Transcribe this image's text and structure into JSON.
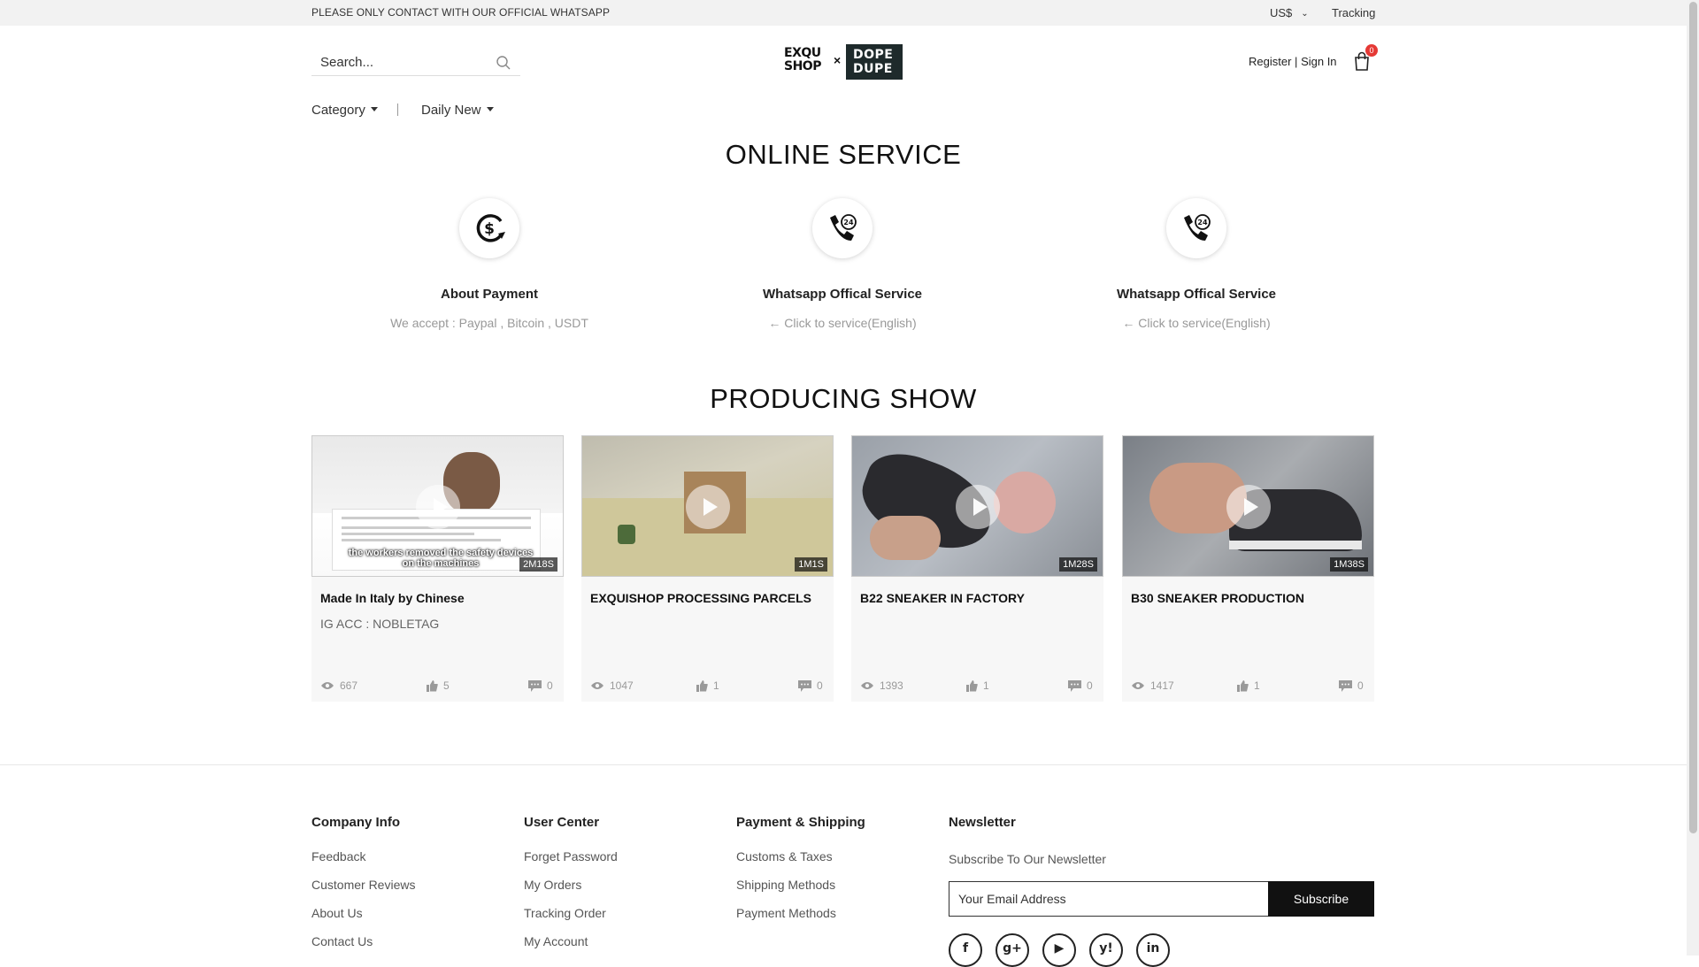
{
  "topbar": {
    "notice": "PLEASE ONLY CONTACT WITH OUR OFFICIAL WHATSAPP",
    "currency": "US$",
    "tracking": "Tracking"
  },
  "header": {
    "search_placeholder": "Search...",
    "logo": {
      "left": "EXQU SHOP",
      "right": "DOPE DUPE"
    },
    "register": "Register",
    "separator": "|",
    "signin": "Sign In",
    "cart_count": "0"
  },
  "nav": {
    "category": "Category",
    "daily_new": "Daily New"
  },
  "online_service": {
    "title": "ONLINE SERVICE",
    "items": [
      {
        "icon": "dollar-cycle-icon",
        "title": "About Payment",
        "desc": "We accept : Paypal , Bitcoin , USDT"
      },
      {
        "icon": "phone-24h-icon",
        "title": "Whatsapp Offical Service",
        "desc": "← Click to service(English)"
      },
      {
        "icon": "phone-24h-icon",
        "title": "Whatsapp Offical Service",
        "desc": "← Click to service(English)"
      }
    ]
  },
  "producing_show": {
    "title": "PRODUCING SHOW",
    "videos": [
      {
        "title": "Made In Italy by Chinese",
        "subtitle": "IG ACC : NOBLETAG",
        "duration": "2M18S",
        "views": "667",
        "likes": "5",
        "comments": "0",
        "caption": "the workers removed the safety devices on the machines"
      },
      {
        "title": "EXQUISHOP PROCESSING PARCELS",
        "subtitle": "",
        "duration": "1M1S",
        "views": "1047",
        "likes": "1",
        "comments": "0"
      },
      {
        "title": "B22 SNEAKER IN FACTORY",
        "subtitle": "",
        "duration": "1M28S",
        "views": "1393",
        "likes": "1",
        "comments": "0"
      },
      {
        "title": "B30 SNEAKER PRODUCTION",
        "subtitle": "",
        "duration": "1M38S",
        "views": "1417",
        "likes": "1",
        "comments": "0"
      }
    ]
  },
  "footer": {
    "company": {
      "heading": "Company Info",
      "links": [
        "Feedback",
        "Customer Reviews",
        "About Us",
        "Contact Us"
      ]
    },
    "user": {
      "heading": "User Center",
      "links": [
        "Forget Password",
        "My Orders",
        "Tracking Order",
        "My Account"
      ]
    },
    "payment": {
      "heading": "Payment & Shipping",
      "links": [
        "Customs & Taxes",
        "Shipping Methods",
        "Payment Methods"
      ]
    },
    "newsletter": {
      "heading": "Newsletter",
      "text": "Subscribe To Our Newsletter",
      "email_placeholder": "Your Email Address",
      "button": "Subscribe"
    },
    "socials": [
      {
        "icon": "facebook-icon",
        "glyph": "f"
      },
      {
        "icon": "google-plus-icon",
        "glyph": "g+"
      },
      {
        "icon": "youtube-icon",
        "glyph": "▶"
      },
      {
        "icon": "yahoo-icon",
        "glyph": "y!"
      },
      {
        "icon": "linkedin-icon",
        "glyph": "in"
      }
    ]
  }
}
